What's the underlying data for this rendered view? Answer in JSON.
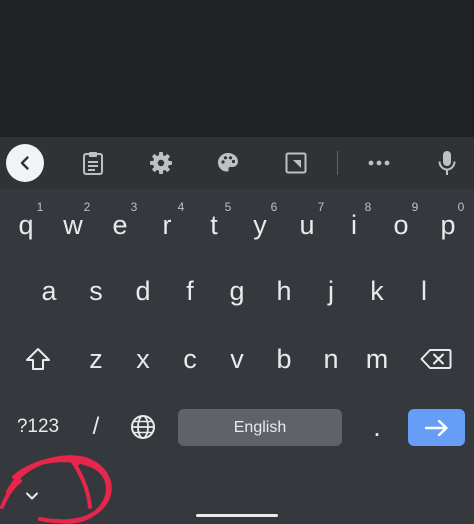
{
  "toolbar": {
    "icons": [
      "chevron-left-icon",
      "clipboard-icon",
      "gear-icon",
      "palette-icon",
      "resize-icon",
      "more-icon",
      "mic-icon"
    ]
  },
  "rows": {
    "row1": [
      "q",
      "w",
      "e",
      "r",
      "t",
      "y",
      "u",
      "i",
      "o",
      "p"
    ],
    "row1_hints": [
      "1",
      "2",
      "3",
      "4",
      "5",
      "6",
      "7",
      "8",
      "9",
      "0"
    ],
    "row2": [
      "a",
      "s",
      "d",
      "f",
      "g",
      "h",
      "j",
      "k",
      "l"
    ],
    "row3": [
      "z",
      "x",
      "c",
      "v",
      "b",
      "n",
      "m"
    ]
  },
  "bottom": {
    "symbols_label": "?123",
    "slash_label": "/",
    "space_label": "English",
    "period_label": "."
  },
  "colors": {
    "accent": "#669df6",
    "annotation": "#e8264c"
  }
}
